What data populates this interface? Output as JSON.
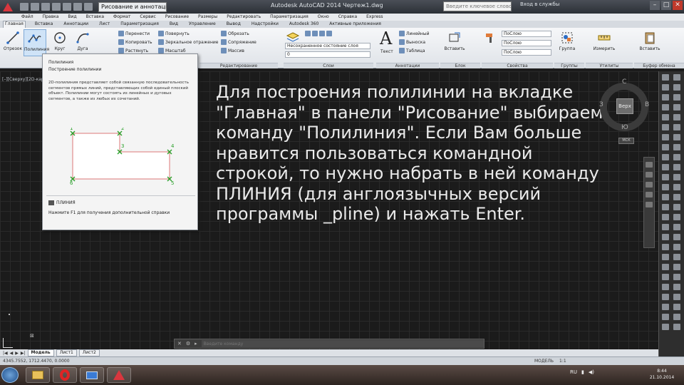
{
  "titlebar": {
    "workspace": "Рисование и аннотации",
    "title": "Autodesk AutoCAD 2014   Чертеж1.dwg",
    "search_placeholder": "Введите ключевое слово/фразу",
    "signin": "Вход в службы",
    "min": "–",
    "max": "□",
    "close": "✕"
  },
  "menubar": [
    "Файл",
    "Правка",
    "Вид",
    "Вставка",
    "Формат",
    "Сервис",
    "Рисование",
    "Размеры",
    "Редактировать",
    "Параметризация",
    "Окно",
    "Справка",
    "Express"
  ],
  "ribbon_tabs": [
    "Главная",
    "Вставка",
    "Аннотации",
    "Лист",
    "Параметризация",
    "Вид",
    "Управление",
    "Вывод",
    "Надстройки",
    "Autodesk 360",
    "Активные приложения"
  ],
  "ribbon": {
    "draw": {
      "line": "Отрезок",
      "polyline": "Полилиния",
      "circle": "Круг",
      "arc": "Дуга",
      "panel": "Рисование"
    },
    "modify": {
      "move": "Перенести",
      "copy": "Копировать",
      "rotate": "Повернуть",
      "mirror": "Зеркальное отражение",
      "trim": "Обрезать",
      "fillet": "Сопряжение",
      "stretch": "Растянуть",
      "scale": "Масштаб",
      "array": "Массив",
      "panel": "Редактирование"
    },
    "layers": {
      "unsaved": "Несохраненное состояние слоя",
      "current": "0",
      "panel": "Слои"
    },
    "annotation": {
      "text": "Текст",
      "linear": "Линейный",
      "leader": "Выноска",
      "table": "Таблица",
      "panel": "Аннотации"
    },
    "block": {
      "insert": "Вставить",
      "panel": "Блок"
    },
    "properties": {
      "color": "ПоСлою",
      "linetype": "ПоСлою",
      "lineweight": "ПоСлою",
      "match": "Копирование свойств",
      "panel": "Свойства"
    },
    "groups": {
      "group": "Группа",
      "panel": "Группы"
    },
    "utilities": {
      "measure": "Измерить",
      "panel": "Утилиты"
    },
    "clipboard": {
      "paste": "Вставить",
      "panel": "Буфер обмена"
    }
  },
  "tooltip": {
    "header": "Полилиния",
    "title": "Построение полилинии",
    "description": "2D-полилиния представляет собой связанную последовательность сегментов прямых линий, представляющих собой единый плоский объект. Полилинии могут состоять из линейных и дуговых сегментов, а также из любых их сочетаний.",
    "points": [
      "1",
      "2",
      "3",
      "4",
      "5",
      "6"
    ],
    "command": "ПЛИНИЯ",
    "help": "Нажмите F1 для получения дополнительной справки"
  },
  "viewport_label": "[–][Сверху][2D-каркас]",
  "slide_text": "Для построения полилинии на вкладке \"Главная\" в панели \"Рисование\" выбираем команду \"Полилиния\". Если Вам больше нравится пользоваться командной строкой, то нужно набрать в ней команду ПЛИНИЯ (для англоязычных версий программы _pline) и нажать Enter.",
  "viewcube": {
    "face": "Верх",
    "north": "С",
    "south": "Ю",
    "west": "З",
    "east": "В",
    "wcs": "МСК"
  },
  "cmdline": {
    "placeholder": "Введите команду"
  },
  "layout_tabs": {
    "model": "Модель",
    "sheet1": "Лист1",
    "sheet2": "Лист2"
  },
  "statusbar": {
    "coords": "4345.7552, 1712.4470, 0.0000",
    "model": "МОДЕЛЬ",
    "scale": "1:1"
  },
  "taskbar": {
    "time": "8:44",
    "date": "21.10.2014",
    "lang": "RU"
  }
}
